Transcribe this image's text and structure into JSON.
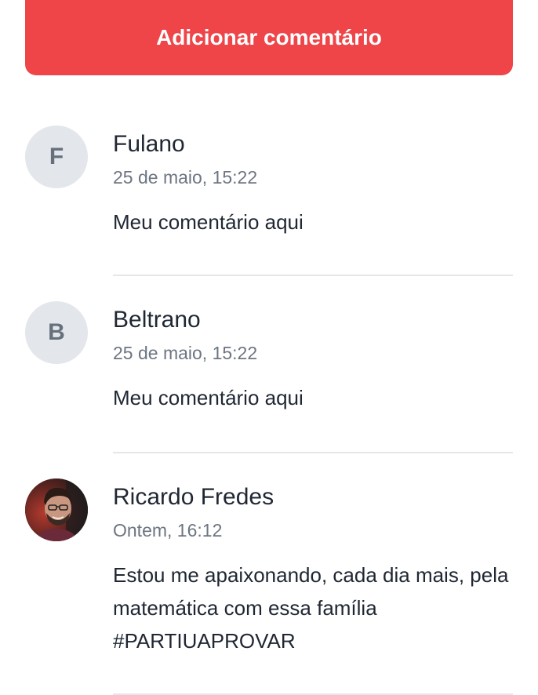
{
  "add_button": {
    "label": "Adicionar comentário"
  },
  "comments": [
    {
      "avatar_initial": "F",
      "author": "Fulano",
      "date": "25 de maio, 15:22",
      "text": "Meu comentário aqui"
    },
    {
      "avatar_initial": "B",
      "author": "Beltrano",
      "date": "25 de maio, 15:22",
      "text": "Meu comentário aqui"
    },
    {
      "avatar_photo": "user-photo",
      "author": "Ricardo Fredes",
      "date": "Ontem, 16:12",
      "text": "Estou me apaixonando, cada dia mais, pela matemática com essa família #PARTIUAPROVAR"
    }
  ],
  "colors": {
    "accent": "#ef4448",
    "avatar_bg": "#e3e6ea",
    "text_primary": "#1f2733",
    "text_secondary": "#6c7581",
    "divider": "#e4e6e9"
  }
}
